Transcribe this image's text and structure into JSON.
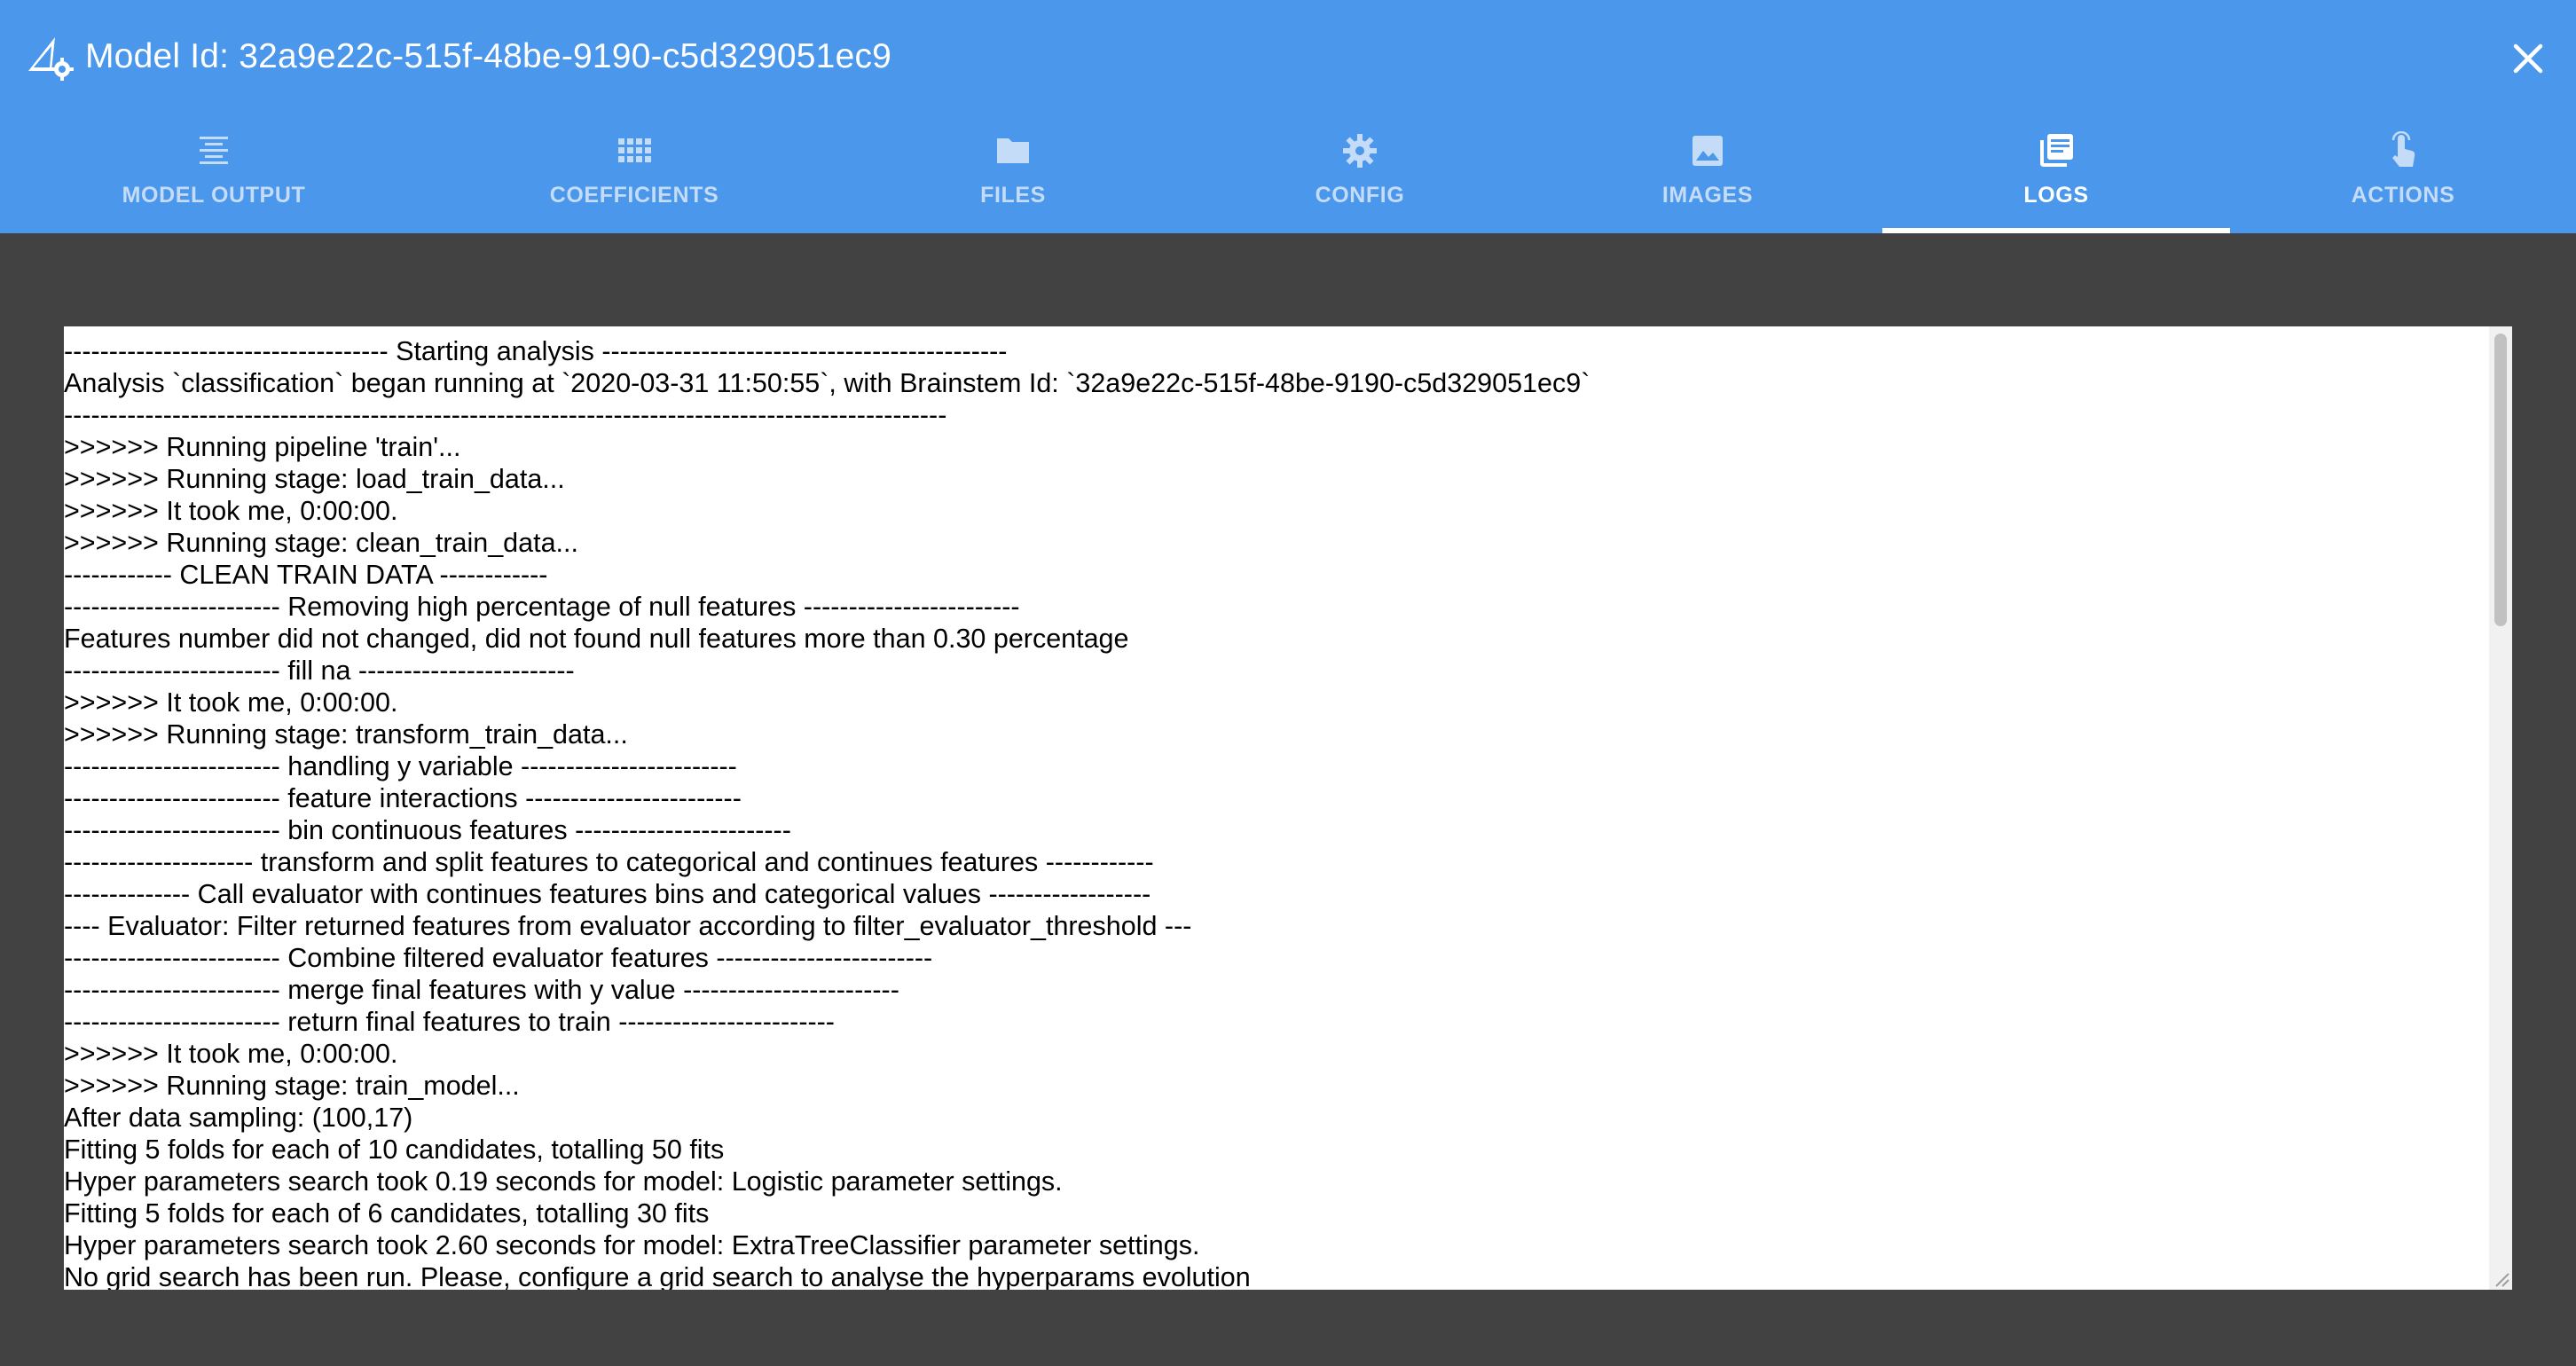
{
  "window": {
    "title": "Model Id: 32a9e22c-515f-48be-9190-c5d329051ec9",
    "app_icon": "model-settings-icon",
    "close_icon": "close-icon"
  },
  "colors": {
    "header": "#4a97eb",
    "background": "#424242",
    "tab_inactive": "#c4dcf7",
    "tab_active": "#ffffff"
  },
  "tabs": [
    {
      "label": "MODEL OUTPUT",
      "icon": "text-align-icon",
      "active": false
    },
    {
      "label": "COEFFICIENTS",
      "icon": "grid-icon",
      "active": false
    },
    {
      "label": "FILES",
      "icon": "folder-icon",
      "active": false
    },
    {
      "label": "CONFIG",
      "icon": "gear-icon",
      "active": false
    },
    {
      "label": "IMAGES",
      "icon": "image-icon",
      "active": false
    },
    {
      "label": "LOGS",
      "icon": "library-books-icon",
      "active": true
    },
    {
      "label": "ACTIONS",
      "icon": "touch-icon",
      "active": false
    }
  ],
  "logs": {
    "lines": [
      "------------------------------------ Starting analysis ---------------------------------------------",
      "Analysis `classification` began running at `2020-03-31 11:50:55`, with Brainstem Id: `32a9e22c-515f-48be-9190-c5d329051ec9`",
      "--------------------------------------------------------------------------------------------------",
      ">>>>>> Running pipeline 'train'...",
      ">>>>>> Running stage: load_train_data...",
      ">>>>>> It took me, 0:00:00.",
      ">>>>>> Running stage: clean_train_data...",
      "------------ CLEAN TRAIN DATA ------------",
      "------------------------ Removing high percentage of null features ------------------------",
      "Features number did not changed, did not found null features more than 0.30 percentage",
      "------------------------ fill na ------------------------",
      ">>>>>> It took me, 0:00:00.",
      ">>>>>> Running stage: transform_train_data...",
      "------------------------ handling y variable ------------------------",
      "------------------------ feature interactions ------------------------",
      "------------------------ bin continuous features ------------------------",
      "--------------------- transform and split features to categorical and continues features ------------",
      "-------------- Call evaluator with continues features bins and categorical values ------------------",
      "---- Evaluator: Filter returned features from evaluator according to filter_evaluator_threshold ---",
      "------------------------ Combine filtered evaluator features ------------------------",
      "------------------------ merge final features with y value ------------------------",
      "------------------------ return final features to train ------------------------",
      ">>>>>> It took me, 0:00:00.",
      ">>>>>> Running stage: train_model...",
      "After data sampling: (100,17)",
      "Fitting 5 folds for each of 10 candidates, totalling 50 fits",
      "Hyper parameters search took 0.19 seconds for model: Logistic parameter settings.",
      "Fitting 5 folds for each of 6 candidates, totalling 30 fits",
      "Hyper parameters search took 2.60 seconds for model: ExtraTreeClassifier parameter settings.",
      "No grid search has been run. Please, configure a grid search to analyse the hyperparams evolution"
    ]
  }
}
